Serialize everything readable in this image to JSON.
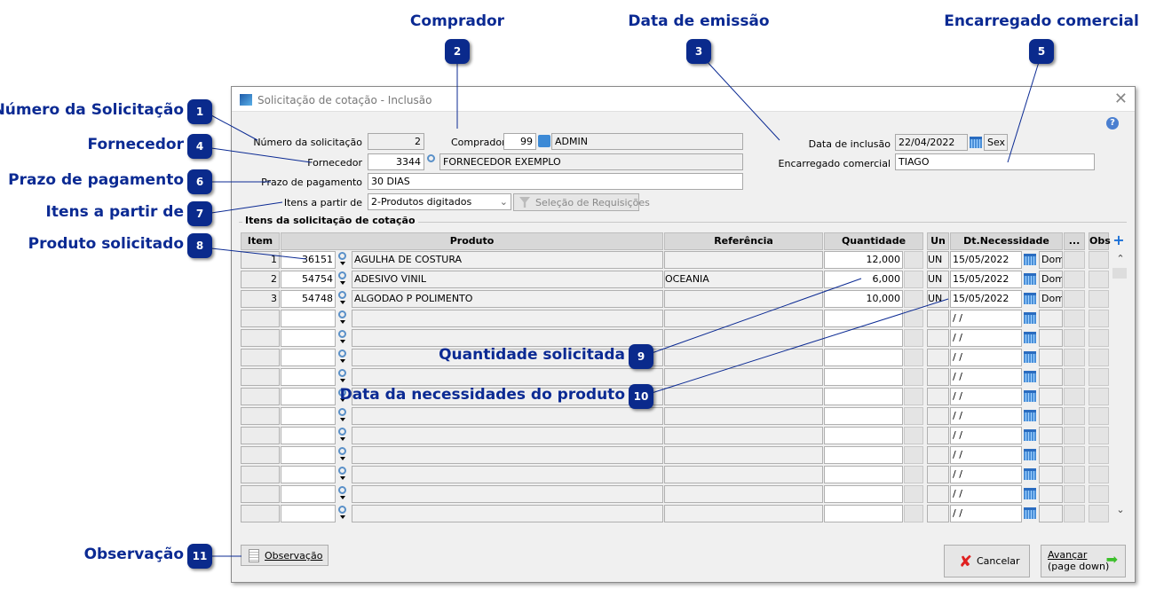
{
  "window": {
    "title": "Solicitação de cotação - Inclusão",
    "close": "✕",
    "help": "?"
  },
  "form": {
    "numero_label": "Número da solicitação",
    "numero_value": "2",
    "comprador_label": "Comprador",
    "comprador_code": "99",
    "comprador_name": "ADMIN",
    "fornecedor_label": "Fornecedor",
    "fornecedor_code": "3344",
    "fornecedor_name": "FORNECEDOR EXEMPLO",
    "prazo_label": "Prazo de pagamento",
    "prazo_value": "30 DIAS",
    "itens_label": "Itens a partir de",
    "itens_value": "2-Produtos digitados",
    "selecao_button": "Seleção de Requisições",
    "data_label": "Data de inclusão",
    "data_value": "22/04/2022",
    "data_day": "Sex",
    "encarregado_label": "Encarregado comercial",
    "encarregado_value": "TIAGO"
  },
  "grid": {
    "title": "Itens da solicitação de cotação",
    "headers": {
      "item": "Item",
      "produto": "Produto",
      "referencia": "Referência",
      "quantidade": "Quantidade",
      "un": "Un",
      "dt": "Dt.Necessidade",
      "more": "...",
      "obs": "Obs"
    },
    "rows": [
      {
        "item": "1",
        "code": "36151",
        "desc": "AGULHA DE COSTURA",
        "ref": "",
        "qty": "12,000",
        "un": "UN",
        "date": "15/05/2022",
        "day": "Dom"
      },
      {
        "item": "2",
        "code": "54754",
        "desc": "ADESIVO VINIL",
        "ref": "OCEANIA",
        "qty": "6,000",
        "un": "UN",
        "date": "15/05/2022",
        "day": "Dom"
      },
      {
        "item": "3",
        "code": "54748",
        "desc": "ALGODAO P POLIMENTO",
        "ref": "",
        "qty": "10,000",
        "un": "UN",
        "date": "15/05/2022",
        "day": "Dom"
      },
      {
        "item": "",
        "code": "",
        "desc": "",
        "ref": "",
        "qty": "",
        "un": "",
        "date": " / /",
        "day": ""
      },
      {
        "item": "",
        "code": "",
        "desc": "",
        "ref": "",
        "qty": "",
        "un": "",
        "date": " / /",
        "day": ""
      },
      {
        "item": "",
        "code": "",
        "desc": "",
        "ref": "",
        "qty": "",
        "un": "",
        "date": " / /",
        "day": ""
      },
      {
        "item": "",
        "code": "",
        "desc": "",
        "ref": "",
        "qty": "",
        "un": "",
        "date": " / /",
        "day": ""
      },
      {
        "item": "",
        "code": "",
        "desc": "",
        "ref": "",
        "qty": "",
        "un": "",
        "date": " / /",
        "day": ""
      },
      {
        "item": "",
        "code": "",
        "desc": "",
        "ref": "",
        "qty": "",
        "un": "",
        "date": " / /",
        "day": ""
      },
      {
        "item": "",
        "code": "",
        "desc": "",
        "ref": "",
        "qty": "",
        "un": "",
        "date": " / /",
        "day": ""
      },
      {
        "item": "",
        "code": "",
        "desc": "",
        "ref": "",
        "qty": "",
        "un": "",
        "date": " / /",
        "day": ""
      },
      {
        "item": "",
        "code": "",
        "desc": "",
        "ref": "",
        "qty": "",
        "un": "",
        "date": " / /",
        "day": ""
      },
      {
        "item": "",
        "code": "",
        "desc": "",
        "ref": "",
        "qty": "",
        "un": "",
        "date": " / /",
        "day": ""
      },
      {
        "item": "",
        "code": "",
        "desc": "",
        "ref": "",
        "qty": "",
        "un": "",
        "date": " / /",
        "day": ""
      }
    ]
  },
  "buttons": {
    "observacao": "Observação",
    "cancelar": "Cancelar",
    "avancar": "Avançar",
    "avancar_sub": "(page down)"
  },
  "callouts": [
    {
      "n": "1",
      "label": "Número da Solicitação"
    },
    {
      "n": "2",
      "label": "Comprador"
    },
    {
      "n": "3",
      "label": "Data de emissão"
    },
    {
      "n": "4",
      "label": "Fornecedor"
    },
    {
      "n": "5",
      "label": "Encarregado comercial"
    },
    {
      "n": "6",
      "label": "Prazo de pagamento"
    },
    {
      "n": "7",
      "label": "Itens a partir de"
    },
    {
      "n": "8",
      "label": "Produto solicitado"
    },
    {
      "n": "9",
      "label": "Quantidade solicitada"
    },
    {
      "n": "10",
      "label": "Data da necessidades do produto"
    },
    {
      "n": "11",
      "label": "Observação"
    }
  ]
}
